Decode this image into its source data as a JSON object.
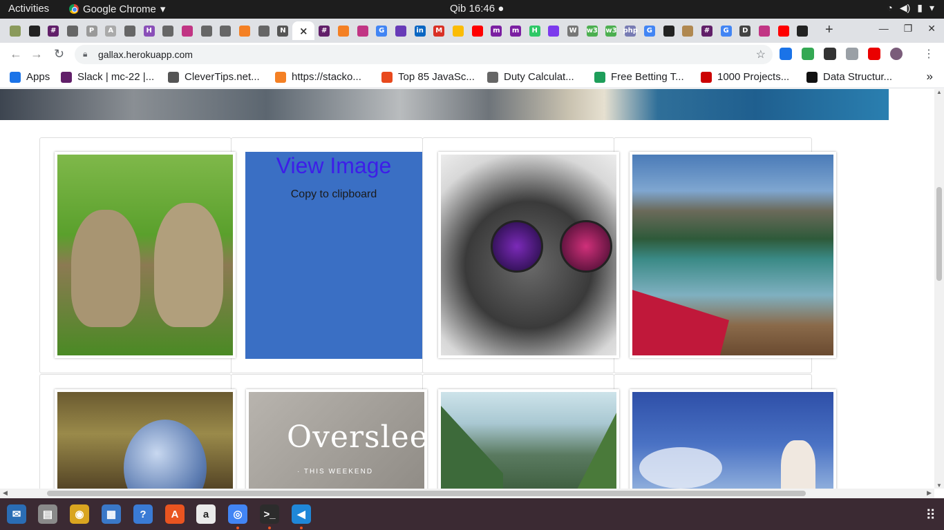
{
  "topbar": {
    "activities": "Activities",
    "app_name": "Google Chrome",
    "clock": "Qib 16:46"
  },
  "tabs": {
    "favicons": [
      {
        "name": "tree-favicon",
        "letter": "",
        "color": "#8a9a5b"
      },
      {
        "name": "github-favicon",
        "letter": "",
        "color": "#222222"
      },
      {
        "name": "slack-favicon",
        "letter": "#",
        "color": "#611f69"
      },
      {
        "name": "globe-favicon",
        "letter": "",
        "color": "#666666"
      },
      {
        "name": "pinterest-favicon",
        "letter": "P",
        "color": "#999999"
      },
      {
        "name": "abbr-favicon",
        "letter": "A",
        "color": "#aaaaaa"
      },
      {
        "name": "globe-favicon",
        "letter": "",
        "color": "#666666"
      },
      {
        "name": "hackerrank-favicon",
        "letter": "H",
        "color": "#8a4fb8"
      },
      {
        "name": "globe-favicon",
        "letter": "",
        "color": "#666666"
      },
      {
        "name": "instagram-favicon",
        "letter": "",
        "color": "#c13584"
      },
      {
        "name": "globe-favicon",
        "letter": "",
        "color": "#666666"
      },
      {
        "name": "globe-favicon",
        "letter": "",
        "color": "#666666"
      },
      {
        "name": "stackoverflow-favicon",
        "letter": "",
        "color": "#f48024"
      },
      {
        "name": "globe-favicon",
        "letter": "",
        "color": "#666666"
      },
      {
        "name": "notion-favicon",
        "letter": "N",
        "color": "#555555"
      }
    ],
    "active_close": "×",
    "favicons_right": [
      {
        "name": "slack-favicon",
        "letter": "#",
        "color": "#611f69"
      },
      {
        "name": "stackoverflow-favicon",
        "letter": "",
        "color": "#f48024"
      },
      {
        "name": "instagram-favicon",
        "letter": "",
        "color": "#c13584"
      },
      {
        "name": "google-favicon",
        "letter": "G",
        "color": "#4285f4"
      },
      {
        "name": "forms-favicon",
        "letter": "",
        "color": "#673ab7"
      },
      {
        "name": "linkedin-favicon",
        "letter": "in",
        "color": "#0a66c2"
      },
      {
        "name": "gmail-favicon",
        "letter": "M",
        "color": "#d93025"
      },
      {
        "name": "photos-favicon",
        "letter": "",
        "color": "#fbbc04"
      },
      {
        "name": "youtube-favicon",
        "letter": "",
        "color": "#ff0000"
      },
      {
        "name": "m-favicon",
        "letter": "m",
        "color": "#7b1fa2"
      },
      {
        "name": "m-favicon",
        "letter": "m",
        "color": "#7b1fa2"
      },
      {
        "name": "h-favicon",
        "letter": "H",
        "color": "#2ec866"
      },
      {
        "name": "grid-favicon",
        "letter": "",
        "color": "#7c3aed"
      },
      {
        "name": "wikipedia-favicon",
        "letter": "W",
        "color": "#777777"
      },
      {
        "name": "w3-favicon",
        "letter": "w3",
        "color": "#4caf50"
      },
      {
        "name": "w3-favicon",
        "letter": "w3",
        "color": "#4caf50"
      },
      {
        "name": "php-favicon",
        "letter": "php",
        "color": "#777bb3"
      },
      {
        "name": "google-favicon",
        "letter": "G",
        "color": "#4285f4"
      },
      {
        "name": "hex-favicon",
        "letter": "",
        "color": "#222222"
      },
      {
        "name": "bird-favicon",
        "letter": "",
        "color": "#b08850"
      },
      {
        "name": "slack-favicon",
        "letter": "#",
        "color": "#611f69"
      },
      {
        "name": "google-favicon",
        "letter": "G",
        "color": "#4285f4"
      },
      {
        "name": "d-favicon",
        "letter": "D",
        "color": "#444444"
      },
      {
        "name": "instagram-favicon",
        "letter": "",
        "color": "#c13584"
      },
      {
        "name": "youtube-favicon",
        "letter": "",
        "color": "#ff0000"
      },
      {
        "name": "github-favicon",
        "letter": "",
        "color": "#222222"
      }
    ],
    "new_tab": "+"
  },
  "toolbar": {
    "url": "gallax.herokuapp.com",
    "extensions": [
      "#1a73e8",
      "#34a853",
      "#333333",
      "#9aa0a6",
      "#ea0000",
      "#7a5c7a"
    ]
  },
  "bookmarks": [
    {
      "label": "Apps",
      "icon": "apps-icon",
      "color": "#1a73e8"
    },
    {
      "label": "Slack | mc-22 |...",
      "icon": "slack-icon",
      "color": "#611f69"
    },
    {
      "label": "CleverTips.net...",
      "icon": "clevertips-icon",
      "color": "#555555"
    },
    {
      "label": "https://stacko...",
      "icon": "stackoverflow-icon",
      "color": "#f48024"
    },
    {
      "label": "Top 85 JavaSc...",
      "icon": "edureka-icon",
      "color": "#e8491d"
    },
    {
      "label": "Duty Calculat...",
      "icon": "globe-icon",
      "color": "#666666"
    },
    {
      "label": "Free Betting T...",
      "icon": "betting-icon",
      "color": "#1e9e5a"
    },
    {
      "label": "1000 Projects...",
      "icon": "projects-icon",
      "color": "#cc0000"
    },
    {
      "label": "Data Structur...",
      "icon": "medium-icon",
      "color": "#111111"
    }
  ],
  "bookmarks_more": "»",
  "gallery": {
    "overlay_view": "View Image",
    "overlay_copy": "Copy to clipboard",
    "oversleep_text": "Oversleep",
    "oversleep_sub": "· THIS WEEKEND"
  },
  "dock": [
    {
      "name": "thunderbird-icon",
      "color": "#2a6db5",
      "glyph": "✉"
    },
    {
      "name": "files-icon",
      "color": "#8a8a8a",
      "glyph": "▤"
    },
    {
      "name": "rhythmbox-icon",
      "color": "#d9a520",
      "glyph": "◉"
    },
    {
      "name": "writer-icon",
      "color": "#3a78c8",
      "glyph": "▦"
    },
    {
      "name": "help-icon",
      "color": "#3a7bd5",
      "glyph": "?"
    },
    {
      "name": "software-icon",
      "color": "#e95420",
      "glyph": "A"
    },
    {
      "name": "amazon-icon",
      "color": "#eaeaea",
      "glyph": "a"
    },
    {
      "name": "chrome-icon",
      "color": "#4285f4",
      "glyph": "◎"
    },
    {
      "name": "terminal-icon",
      "color": "#2c2c2c",
      "glyph": ">_"
    },
    {
      "name": "vscode-icon",
      "color": "#1f87d8",
      "glyph": "◀"
    }
  ]
}
